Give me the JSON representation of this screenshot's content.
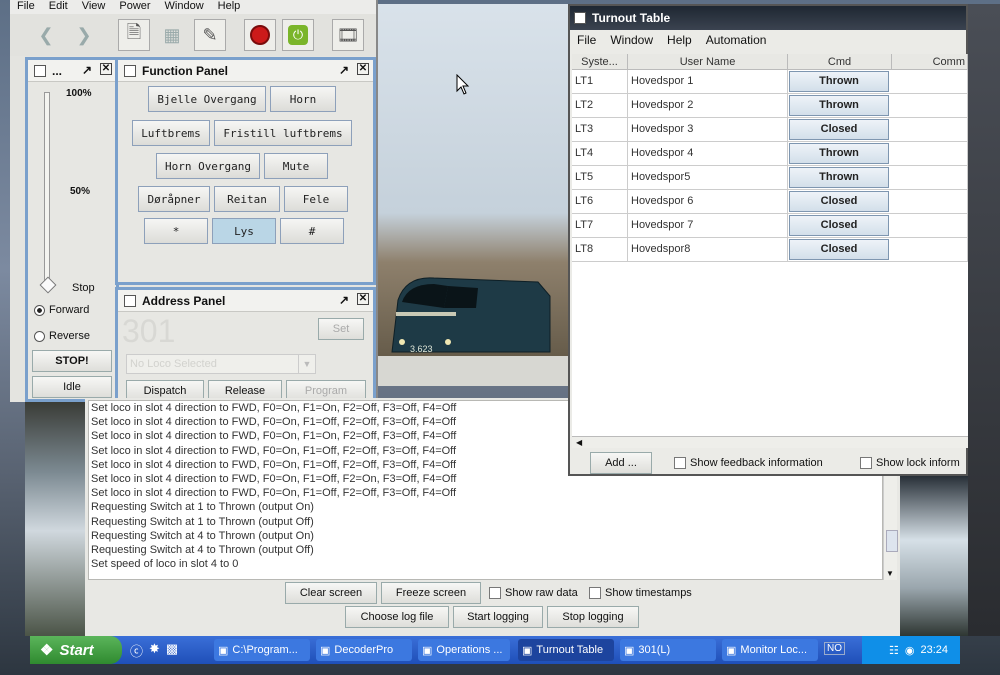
{
  "main_menu": [
    "File",
    "Edit",
    "View",
    "Power",
    "Window",
    "Help"
  ],
  "throttle": {
    "pct100": "100%",
    "pct50": "50%",
    "stop_label": "Stop",
    "forward": "Forward",
    "reverse": "Reverse",
    "stop_btn": "STOP!",
    "idle_btn": "Idle",
    "title": "..."
  },
  "function_panel": {
    "title": "Function Panel",
    "buttons": [
      "Bjelle Overgang",
      "Horn",
      "Luftbrems",
      "Fristill luftbrems",
      "Horn Overgang",
      "Mute",
      "Døråpner",
      "Reitan",
      "Fele",
      "*",
      "Lys",
      "#"
    ]
  },
  "address_panel": {
    "title": "Address Panel",
    "address": "301",
    "set": "Set",
    "roster_placeholder": "No Loco Selected",
    "dispatch": "Dispatch",
    "release": "Release",
    "program": "Program"
  },
  "log": {
    "lines": [
      "Set loco in slot 4 direction to FWD, F0=On,  F1=On,  F2=Off, F3=Off, F4=Off",
      "Set loco in slot 4 direction to FWD, F0=On,  F1=Off, F2=Off, F3=Off, F4=Off",
      "Set loco in slot 4 direction to FWD, F0=On,  F1=On,  F2=Off,  F3=Off, F4=Off",
      "Set loco in slot 4 direction to FWD, F0=On,  F1=Off, F2=Off, F3=Off, F4=Off",
      "Set loco in slot 4 direction to FWD, F0=On,  F1=Off, F2=Off, F3=Off, F4=Off",
      "Set loco in slot 4 direction to FWD, F0=On,  F1=Off, F2=On,  F3=Off, F4=Off",
      "Set loco in slot 4 direction to FWD, F0=On,  F1=Off, F2=Off, F3=Off, F4=Off",
      "Requesting Switch at 1 to Thrown (output On)",
      "Requesting Switch at 1 to Thrown (output Off)",
      "Requesting Switch at 4 to Thrown (output On)",
      "Requesting Switch at 4 to Thrown (output Off)",
      "Set speed of loco in slot 4 to 0"
    ],
    "clear": "Clear screen",
    "freeze": "Freeze screen",
    "show_raw": "Show raw data",
    "show_ts": "Show timestamps",
    "choose_file": "Choose log file",
    "start_logging": "Start logging",
    "stop_logging": "Stop logging"
  },
  "turnout": {
    "title": "Turnout Table",
    "menu": [
      "File",
      "Window",
      "Help",
      "Automation"
    ],
    "headers": [
      "Syste...",
      "User Name",
      "Cmd",
      "Comm"
    ],
    "rows": [
      {
        "sys": "LT1",
        "user": "Hovedspor 1",
        "cmd": "Thrown"
      },
      {
        "sys": "LT2",
        "user": "Hovedspor 2",
        "cmd": "Thrown"
      },
      {
        "sys": "LT3",
        "user": "Hovedspor 3",
        "cmd": "Closed"
      },
      {
        "sys": "LT4",
        "user": "Hovedspor 4",
        "cmd": "Thrown"
      },
      {
        "sys": "LT5",
        "user": "Hovedspor5",
        "cmd": "Thrown"
      },
      {
        "sys": "LT6",
        "user": "Hovedspor 6",
        "cmd": "Closed"
      },
      {
        "sys": "LT7",
        "user": "Hovedspor 7",
        "cmd": "Closed"
      },
      {
        "sys": "LT8",
        "user": "Hovedspor8",
        "cmd": "Closed"
      }
    ],
    "add": "Add ...",
    "show_feedback": "Show feedback information",
    "show_lock": "Show lock inform"
  },
  "locomotive_number": "3.623",
  "taskbar": {
    "start": "Start",
    "tasks": [
      "C:\\Program...",
      "DecoderPro",
      "Operations ...",
      "Turnout Table",
      "301(L)",
      "Monitor Loc..."
    ],
    "no_label": "NO",
    "time": "23:24"
  }
}
